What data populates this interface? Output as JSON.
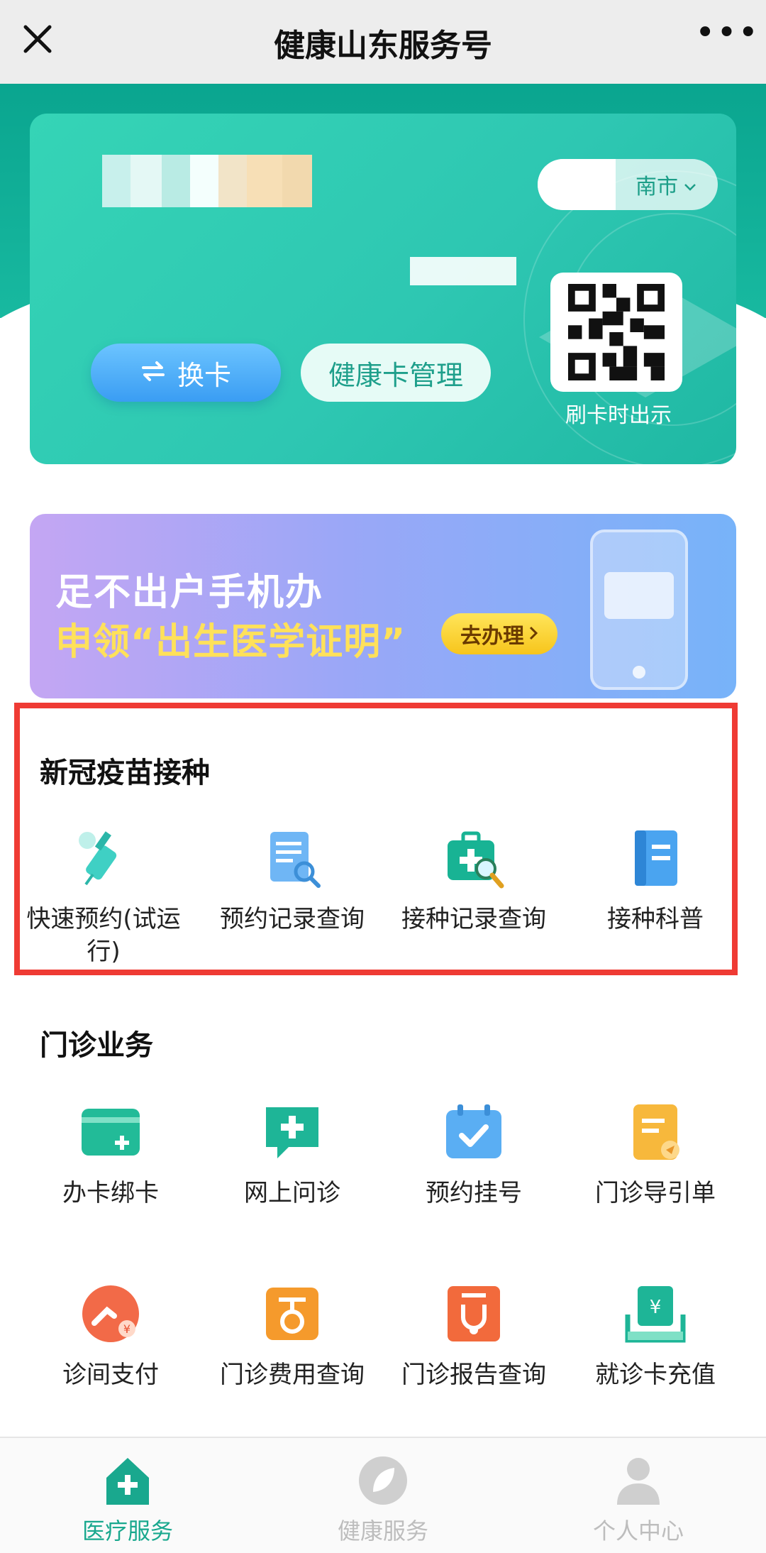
{
  "nav": {
    "title": "健康山东服务号",
    "more": "•••"
  },
  "card": {
    "city": "南市",
    "switch_label": "换卡",
    "manage_label": "健康卡管理",
    "qr_caption": "刷卡时出示"
  },
  "banner": {
    "line1": "足不出户手机办",
    "line2": "申领“出生医学证明”",
    "button": "去办理"
  },
  "vaccine": {
    "title": "新冠疫苗接种",
    "items": [
      {
        "label": "快速预约(试运行)",
        "icon": "syringe-icon"
      },
      {
        "label": "预约记录查询",
        "icon": "document-search-icon"
      },
      {
        "label": "接种记录查询",
        "icon": "medkit-search-icon"
      },
      {
        "label": "接种科普",
        "icon": "book-icon"
      }
    ]
  },
  "outpatient": {
    "title": "门诊业务",
    "items": [
      {
        "label": "办卡绑卡",
        "icon": "card-add-icon"
      },
      {
        "label": "网上问诊",
        "icon": "chat-plus-icon"
      },
      {
        "label": "预约挂号",
        "icon": "calendar-check-icon"
      },
      {
        "label": "门诊导引单",
        "icon": "guide-sheet-icon"
      },
      {
        "label": "诊间支付",
        "icon": "payment-icon"
      },
      {
        "label": "门诊费用查询",
        "icon": "fee-query-icon"
      },
      {
        "label": "门诊报告查询",
        "icon": "stethoscope-report-icon"
      },
      {
        "label": "就诊卡充值",
        "icon": "card-recharge-icon"
      }
    ]
  },
  "tabs": [
    {
      "label": "医疗服务",
      "icon": "hospital-icon",
      "active": true
    },
    {
      "label": "健康服务",
      "icon": "leaf-icon",
      "active": false
    },
    {
      "label": "个人中心",
      "icon": "person-icon",
      "active": false
    }
  ],
  "colors": {
    "teal": "#1bb89f",
    "active_tab": "#19a88e",
    "inactive_tab": "#bdbdbd",
    "highlight_border": "#ef3b34"
  }
}
